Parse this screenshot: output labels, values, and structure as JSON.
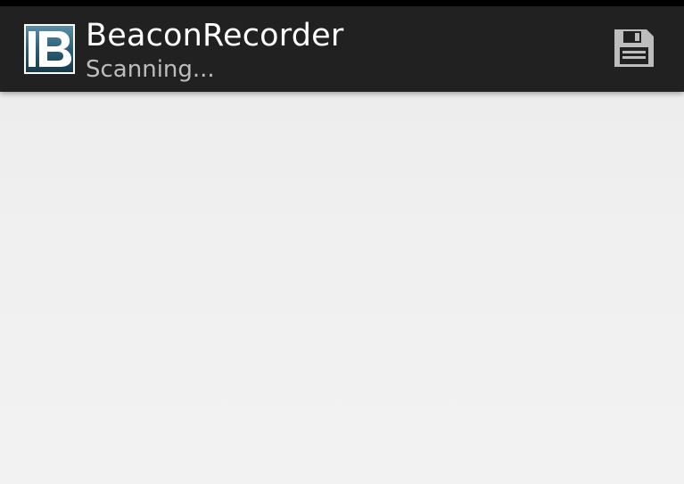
{
  "action_bar": {
    "title": "BeaconRecorder",
    "subtitle": "Scanning...",
    "logo_icon": "app-logo-b-icon",
    "save_icon": "save-floppy-icon"
  },
  "colors": {
    "action_bar_bg": "#212121",
    "title_text": "#ffffff",
    "subtitle_text": "#bdbdbd",
    "content_bg": "#f0f0f0",
    "icon_gray": "#bdbdbd"
  }
}
